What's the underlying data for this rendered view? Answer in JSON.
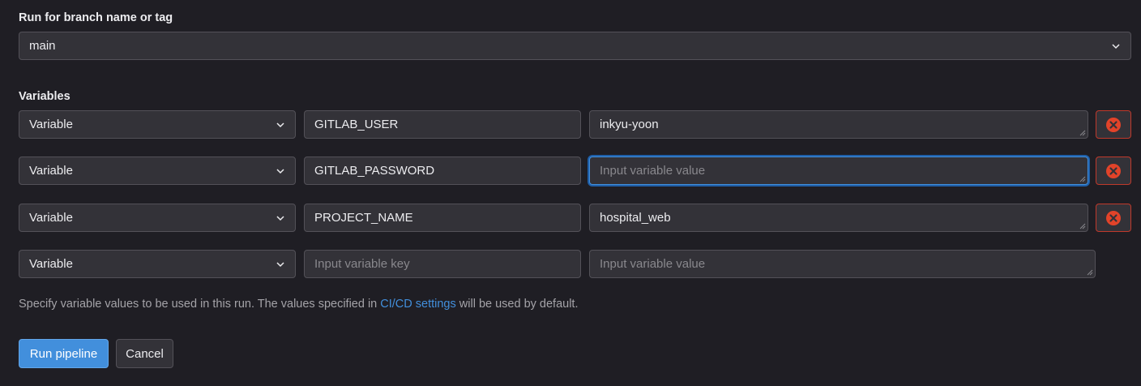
{
  "branch": {
    "label": "Run for branch name or tag",
    "selected": "main"
  },
  "variables": {
    "label": "Variables",
    "rows": [
      {
        "type": "Variable",
        "key": "GITLAB_USER",
        "value": "inkyu-yoon",
        "value_placeholder": "Input variable value",
        "key_placeholder": "Input variable key"
      },
      {
        "type": "Variable",
        "key": "GITLAB_PASSWORD",
        "value": "",
        "value_placeholder": "Input variable value",
        "key_placeholder": "Input variable key"
      },
      {
        "type": "Variable",
        "key": "PROJECT_NAME",
        "value": "hospital_web",
        "value_placeholder": "Input variable value",
        "key_placeholder": "Input variable key"
      },
      {
        "type": "Variable",
        "key": "",
        "value": "",
        "key_placeholder": "Input variable key",
        "value_placeholder": "Input variable value"
      }
    ]
  },
  "help": {
    "before": "Specify variable values to be used in this run. The values specified in ",
    "link": "CI/CD settings",
    "after": " will be used by default."
  },
  "actions": {
    "run_label": "Run pipeline",
    "cancel_label": "Cancel"
  },
  "colors": {
    "background": "#1f1e24",
    "primary": "#428fdc",
    "danger": "#e24329"
  },
  "icons": {
    "chevron": "chevron-down-icon",
    "remove": "remove-circle-icon"
  }
}
